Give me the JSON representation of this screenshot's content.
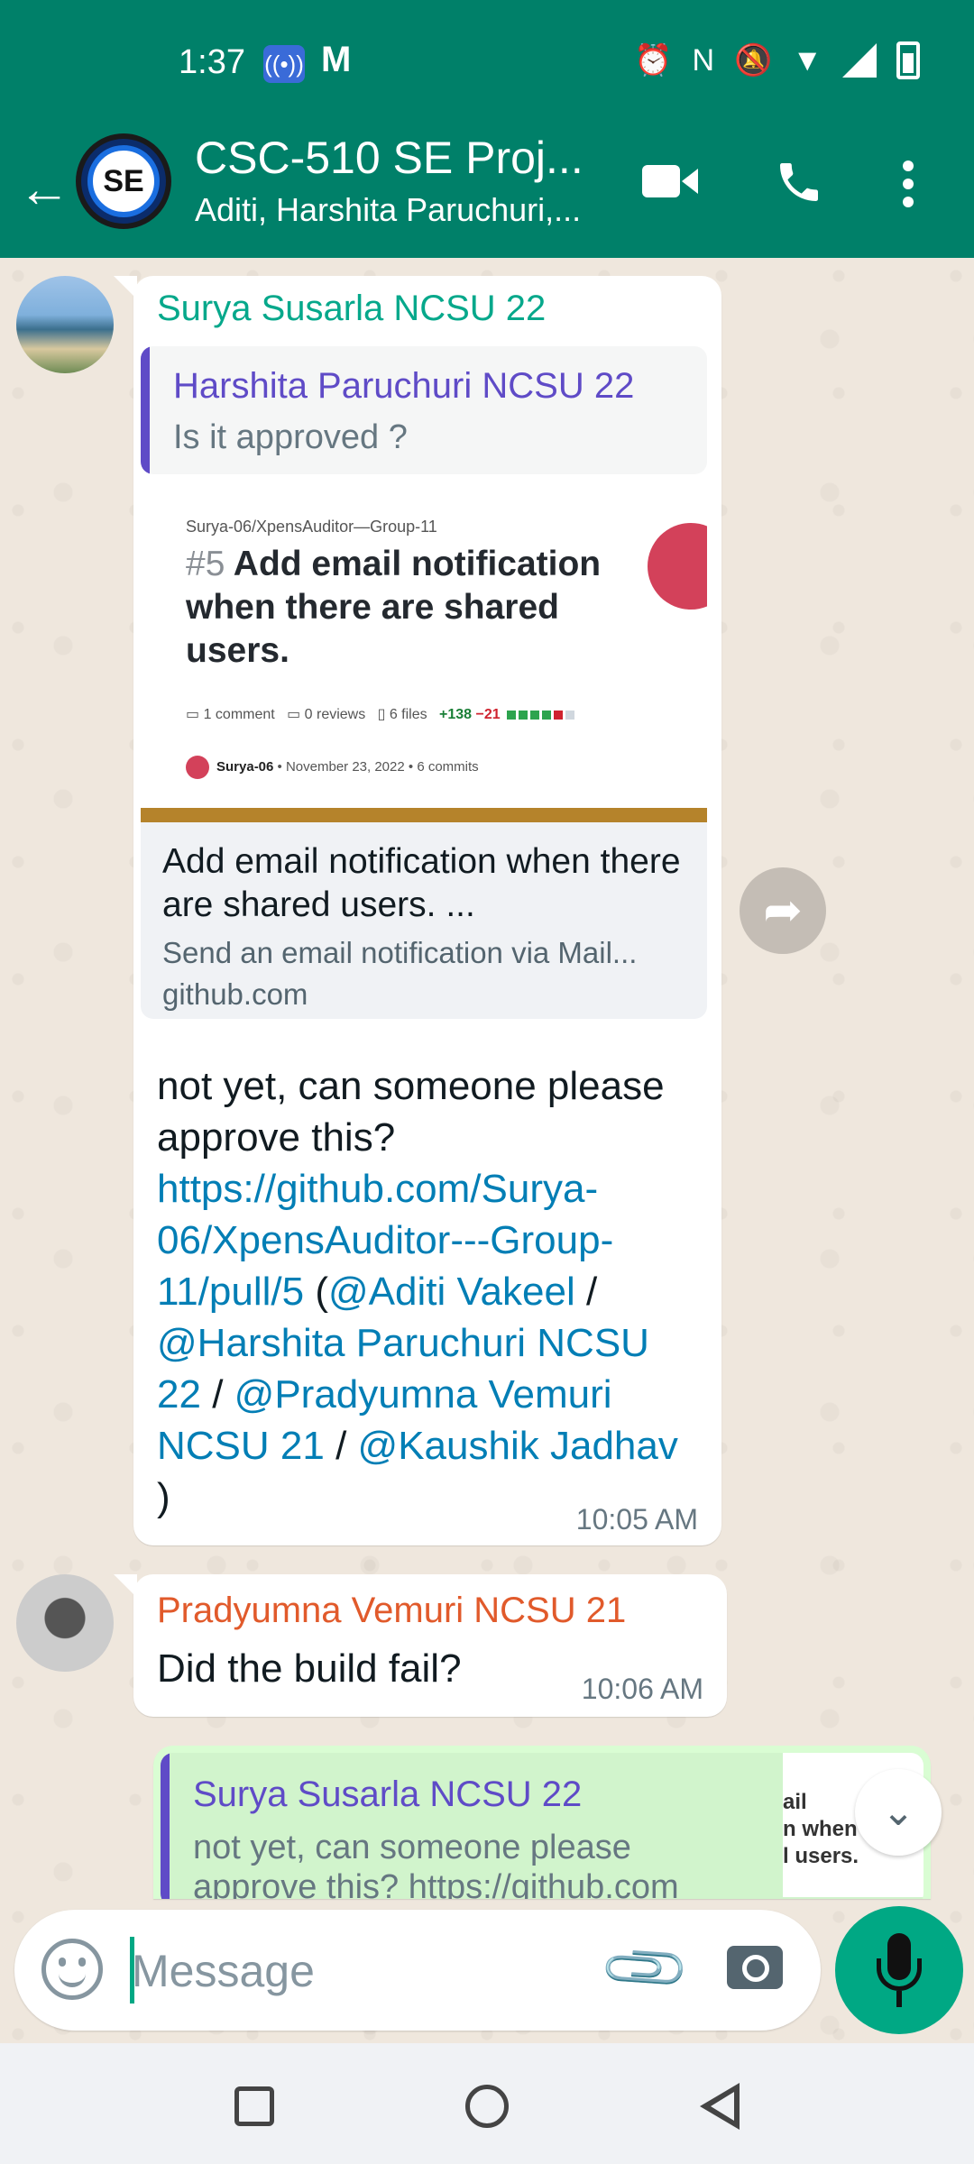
{
  "status_bar": {
    "time": "1:37",
    "icons": [
      "hotspot-icon",
      "gmail-icon",
      "alarm-icon",
      "nfc-icon",
      "vibrate-off-icon",
      "wifi-icon",
      "signal-icon",
      "battery-icon"
    ]
  },
  "header": {
    "avatar_text": "SE",
    "title": "CSC-510 SE Proj...",
    "subtitle": "Aditi, Harshita Paruchuri,..."
  },
  "colors": {
    "accent": "#008069",
    "sender_green": "#06a88b",
    "sender_orange": "#e15a2b",
    "quote_purple": "#5f4bc7",
    "link_blue": "#027eb5",
    "outgoing_bubble": "#d9fdd3"
  },
  "messages": [
    {
      "sender": "Surya Susarla NCSU 22",
      "quote": {
        "name": "Harshita Paruchuri NCSU 22",
        "text": "Is it approved ?"
      },
      "preview": {
        "repo": "Surya-06/XpensAuditor—Group-11",
        "pr_number": "#5",
        "pr_title": "Add email notification when there are shared users.",
        "comments": "1 comment",
        "reviews": "0 reviews",
        "files": "6 files",
        "additions": "+138",
        "deletions": "−21",
        "user": "Surya-06",
        "date": "• November 23, 2022 •",
        "commits": "6 commits",
        "title": "Add email notification when there are shared users. ...",
        "description": "Send an email notification via Mail...",
        "domain": "github.com"
      },
      "text_plain": "not yet, can someone please approve this?",
      "link": "https://github.com/Surya-06/XpensAuditor---Group-11/pull/5",
      "mentions": [
        "@Aditi Vakeel",
        "@Harshita Paruchuri NCSU 22",
        "@Pradyumna Vemuri NCSU 21",
        "@Kaushik Jadhav"
      ],
      "separator": "/",
      "open_paren": " (",
      "close_paren": " )",
      "time": "10:05 AM"
    },
    {
      "sender": "Pradyumna Vemuri NCSU 21",
      "text": "Did the build fail?",
      "time": "10:06 AM"
    },
    {
      "quote": {
        "name": "Surya Susarla NCSU 22",
        "text": "not yet, can someone please",
        "text2": "approve this? https://github.com"
      },
      "thumb_lines": [
        "ail",
        "n when there",
        "l users."
      ]
    }
  ],
  "input": {
    "placeholder": "Message"
  }
}
